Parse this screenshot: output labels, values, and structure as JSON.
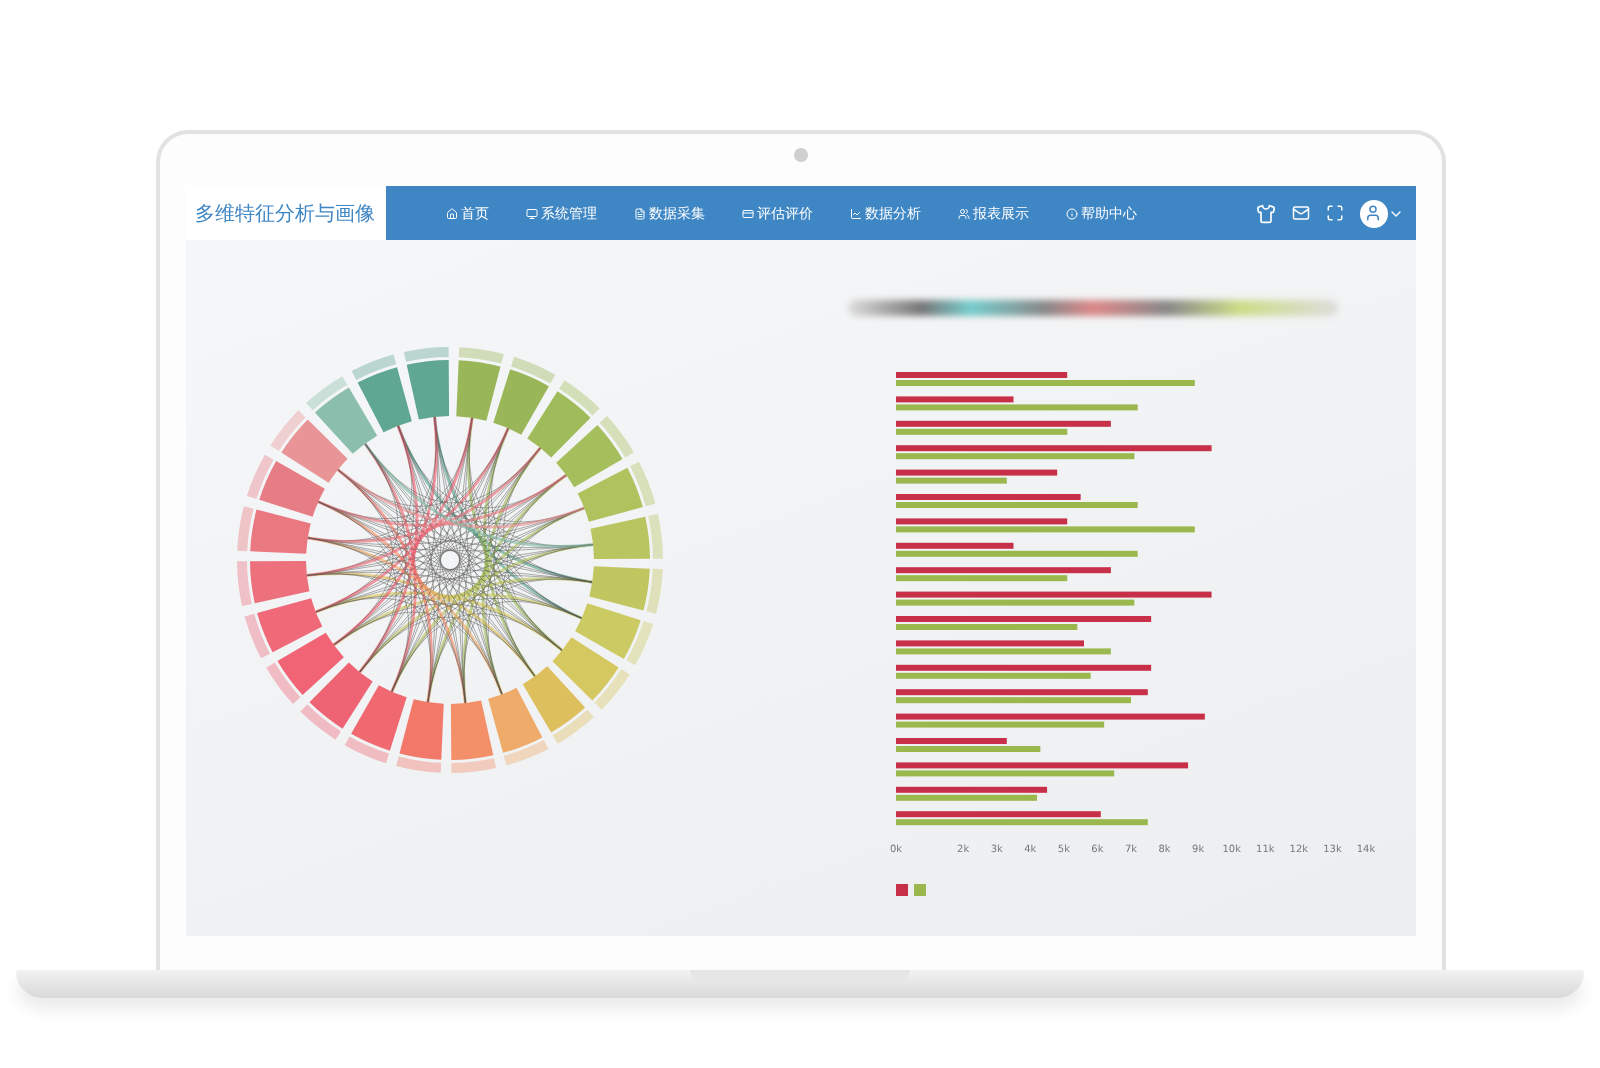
{
  "header": {
    "title": "多维特征分析与画像",
    "nav": [
      {
        "label": "首页"
      },
      {
        "label": "系统管理"
      },
      {
        "label": "数据采集"
      },
      {
        "label": "评估评价"
      },
      {
        "label": "数据分析"
      },
      {
        "label": "报表展示"
      },
      {
        "label": "帮助中心"
      }
    ]
  },
  "bar_chart": {
    "chart_data": {
      "type": "bar",
      "orientation": "horizontal",
      "xlim": [
        0,
        14
      ],
      "xticks": [
        {
          "value": 0,
          "label": "0k"
        },
        {
          "value": 2,
          "label": "2k"
        },
        {
          "value": 3,
          "label": "3k"
        },
        {
          "value": 4,
          "label": "4k"
        },
        {
          "value": 5,
          "label": "5k"
        },
        {
          "value": 6,
          "label": "6k"
        },
        {
          "value": 7,
          "label": "7k"
        },
        {
          "value": 8,
          "label": "8k"
        },
        {
          "value": 9,
          "label": "9k"
        },
        {
          "value": 10,
          "label": "10k"
        },
        {
          "value": 11,
          "label": "11k"
        },
        {
          "value": 12,
          "label": "12k"
        },
        {
          "value": 13,
          "label": "13k"
        },
        {
          "value": 14,
          "label": "14k"
        }
      ],
      "series": [
        {
          "color": "#c8304a",
          "values": [
            5.1,
            3.5,
            6.4,
            9.4,
            4.8,
            5.5,
            5.1,
            3.5,
            6.4,
            9.4,
            7.6,
            5.6,
            7.6,
            7.5,
            9.2,
            3.3,
            8.7,
            4.5,
            6.1
          ]
        },
        {
          "color": "#9ab84e",
          "values": [
            8.9,
            7.2,
            5.1,
            7.1,
            3.3,
            7.2,
            8.9,
            7.2,
            5.1,
            7.1,
            5.4,
            6.4,
            5.8,
            7.0,
            6.2,
            4.3,
            6.5,
            4.2,
            7.5
          ]
        }
      ]
    }
  }
}
